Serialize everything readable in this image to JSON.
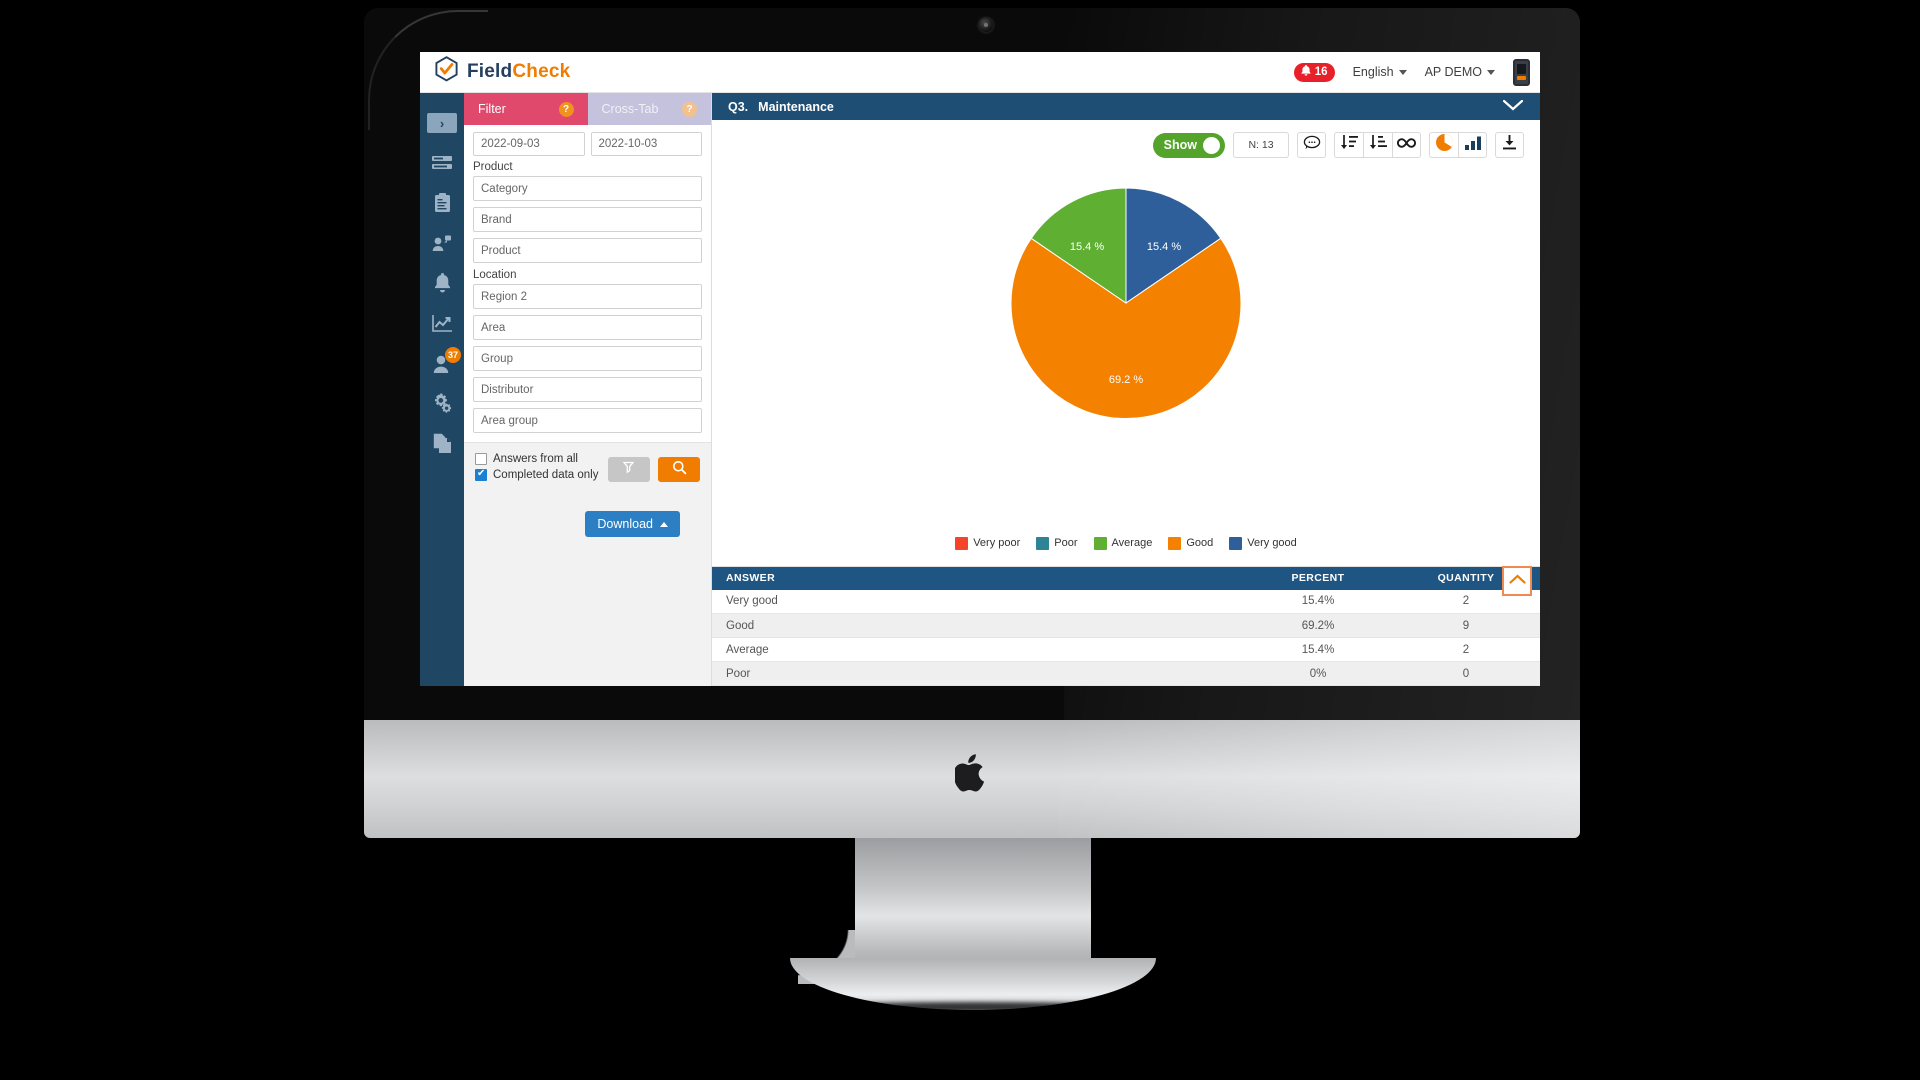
{
  "header": {
    "brand_first": "Field",
    "brand_second": "Check",
    "notification_count": "16",
    "language": "English",
    "account": "AP DEMO",
    "notification_icon": "bell-icon",
    "device_icon": "mobile-device-icon"
  },
  "rail": {
    "items": [
      {
        "name": "toggle-expand",
        "icon": "chevron-right-icon",
        "glyph": "›",
        "badge": ""
      },
      {
        "name": "list",
        "icon": "list-icon",
        "badge": ""
      },
      {
        "name": "reports",
        "icon": "clipboard-icon",
        "badge": ""
      },
      {
        "name": "broadcast",
        "icon": "user-broadcast-icon",
        "badge": ""
      },
      {
        "name": "notifications",
        "icon": "bell-icon",
        "badge": ""
      },
      {
        "name": "analytics",
        "icon": "chart-line-icon",
        "badge": ""
      },
      {
        "name": "users",
        "icon": "user-icon",
        "badge": "37"
      },
      {
        "name": "settings",
        "icon": "gears-icon",
        "badge": ""
      },
      {
        "name": "documents",
        "icon": "documents-icon",
        "badge": ""
      }
    ]
  },
  "filter": {
    "tabs": [
      {
        "label": "Filter",
        "help": "?",
        "active": true
      },
      {
        "label": "Cross-Tab",
        "help": "?",
        "active": false
      }
    ],
    "date_from": "2022-09-03",
    "date_to": "2022-10-03",
    "product_label": "Product",
    "product_fields": [
      "Category",
      "Brand",
      "Product"
    ],
    "location_label": "Location",
    "location_fields": [
      "Region 2",
      "Area",
      "Group",
      "Distributor",
      "Area group"
    ],
    "checkbox_answers_all": "Answers from all",
    "checkbox_completed_only": "Completed data only",
    "answers_all_checked": false,
    "completed_only_checked": true,
    "reset_icon": "reset-filter-icon",
    "search_icon": "search-icon",
    "download_label": "Download",
    "download_caret": "caret-up-icon"
  },
  "question": {
    "number": "Q3.",
    "title": "Maintenance",
    "collapse_icon": "chevron-down-icon"
  },
  "toolbar": {
    "show_label": "Show",
    "show_on": true,
    "n_label": "N: 13",
    "buttons": [
      {
        "name": "comment-button",
        "icon": "comment-icon"
      },
      {
        "name": "sort-ascending-button",
        "icon": "sort-ascending-icon"
      },
      {
        "name": "sort-descending-button",
        "icon": "sort-descending-icon"
      },
      {
        "name": "infinity-button",
        "icon": "infinity-icon"
      },
      {
        "name": "pie-chart-button",
        "icon": "pie-chart-icon"
      },
      {
        "name": "bar-chart-button",
        "icon": "bar-chart-icon"
      },
      {
        "name": "download-button",
        "icon": "download-icon"
      }
    ]
  },
  "chart_data": {
    "type": "pie",
    "title": "Q3. Maintenance",
    "categories": [
      "Very poor",
      "Poor",
      "Average",
      "Good",
      "Very good"
    ],
    "values": [
      0,
      0,
      15.4,
      69.2,
      15.4
    ],
    "quantities": [
      0,
      0,
      2,
      9,
      2
    ],
    "colors": [
      "#f4452a",
      "#2e8397",
      "#5faf32",
      "#f58100",
      "#2e5f9a"
    ],
    "data_labels": [
      "15.4 %",
      "69.2 %",
      "15.4 %"
    ],
    "slice_order": [
      "Very good",
      "Good",
      "Average"
    ],
    "slice_values": [
      15.4,
      69.2,
      15.4
    ],
    "slice_colors": [
      "#2e5f9a",
      "#f58100",
      "#5faf32"
    ],
    "legend_position": "bottom",
    "total_n": 13
  },
  "table": {
    "columns": [
      "ANSWER",
      "PERCENT",
      "QUANTITY"
    ],
    "rows": [
      {
        "answer": "Very good",
        "percent": "15.4%",
        "quantity": "2"
      },
      {
        "answer": "Good",
        "percent": "69.2%",
        "quantity": "9"
      },
      {
        "answer": "Average",
        "percent": "15.4%",
        "quantity": "2"
      },
      {
        "answer": "Poor",
        "percent": "0%",
        "quantity": "0"
      }
    ],
    "collapse_icon": "chevron-up-icon"
  }
}
